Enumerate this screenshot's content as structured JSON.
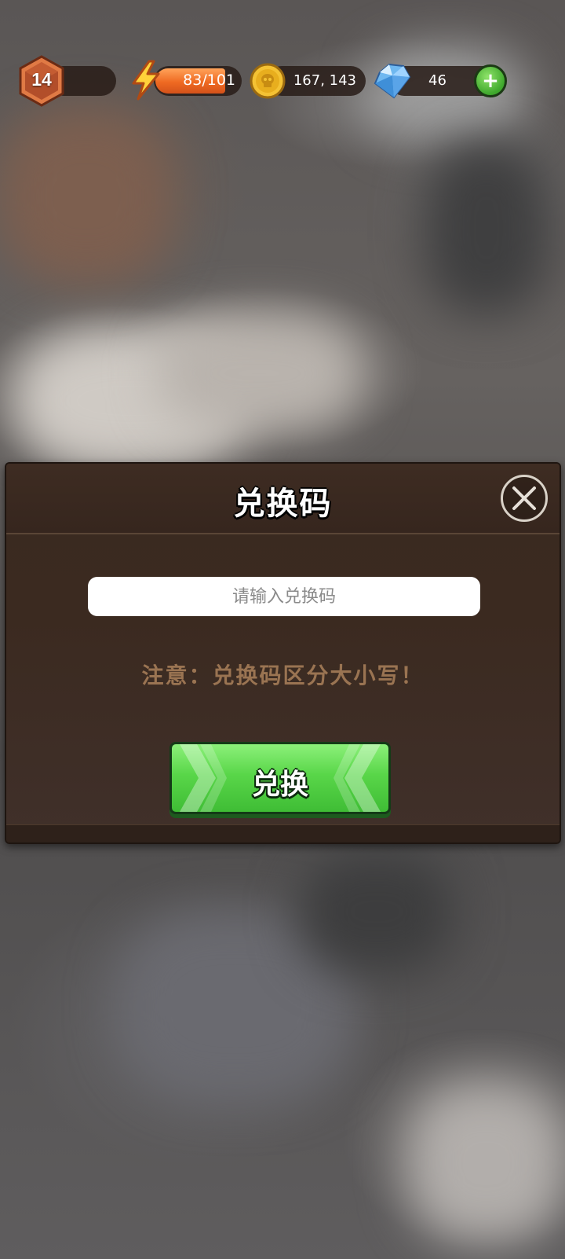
{
  "hud": {
    "level": "14",
    "energy": "83/101",
    "energy_fraction": 0.82,
    "coins": "167, 143",
    "gems": "46",
    "add_label": "+",
    "icons": {
      "level": "hexagon-level-badge-icon",
      "energy": "lightning-bolt-icon",
      "coins": "gold-skull-coin-icon",
      "gems": "blue-diamond-icon",
      "add": "plus-icon"
    }
  },
  "dialog": {
    "title": "兑换码",
    "input_placeholder": "请输入兑换码",
    "input_value": "",
    "notice": "注意：兑换码区分大小写！",
    "redeem_label": "兑换",
    "close_icon": "close-x-icon"
  },
  "colors": {
    "dialog_bg": "#3a2a21",
    "notice_text": "#9a7452",
    "button_green": "#59d649",
    "energy_orange": "#ef6a22"
  }
}
